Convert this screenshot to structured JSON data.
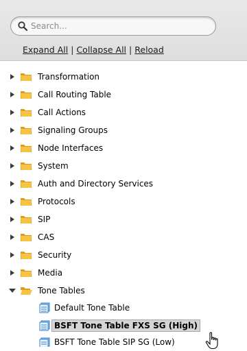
{
  "search": {
    "placeholder": "Search..."
  },
  "actions": {
    "expand_all": "Expand All",
    "sep1": "|",
    "collapse_all": "Collapse All",
    "sep2": "|",
    "reload": "Reload"
  },
  "tree": {
    "items": [
      {
        "label": "Transformation"
      },
      {
        "label": "Call Routing Table"
      },
      {
        "label": "Call Actions"
      },
      {
        "label": "Signaling Groups"
      },
      {
        "label": "Node Interfaces"
      },
      {
        "label": "System"
      },
      {
        "label": "Auth and Directory Services"
      },
      {
        "label": "Protocols"
      },
      {
        "label": "SIP"
      },
      {
        "label": "CAS"
      },
      {
        "label": "Security"
      },
      {
        "label": "Media"
      },
      {
        "label": "Tone Tables",
        "expanded": true
      }
    ],
    "children": [
      {
        "label": "Default Tone Table"
      },
      {
        "label": "BSFT Tone Table FXS SG (High)",
        "selected": true
      },
      {
        "label": "BSFT Tone Table SIP SG (Low)"
      }
    ]
  },
  "colors": {
    "folder": "#f2b533",
    "selection": "#d5d5d5",
    "table_icon": "#4a90d9"
  }
}
